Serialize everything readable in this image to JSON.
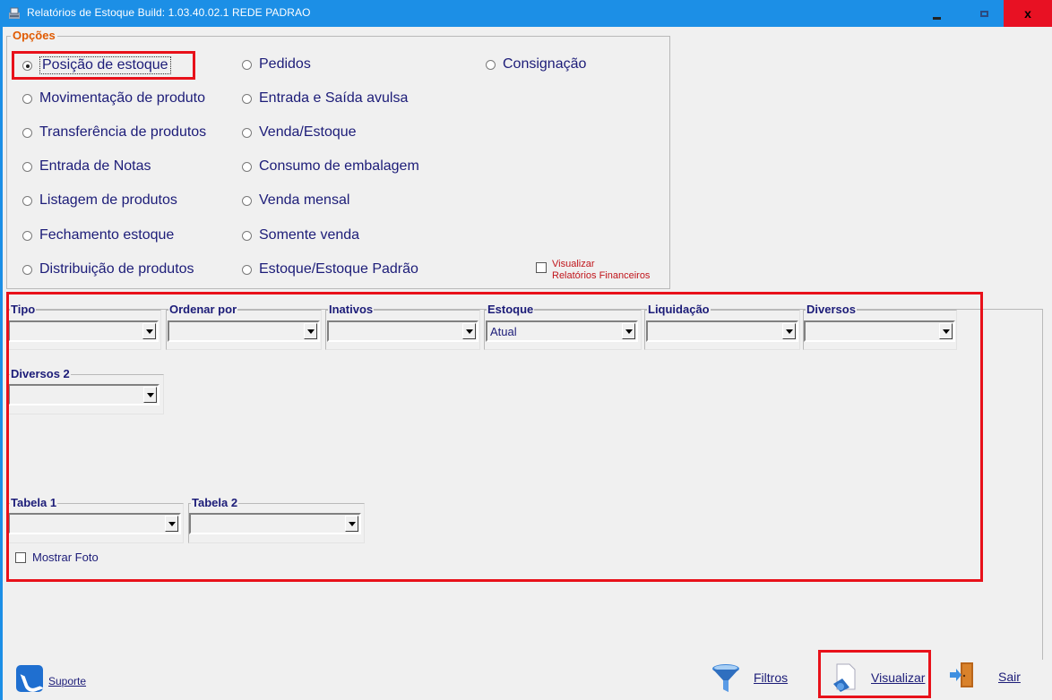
{
  "window": {
    "title": "Relatórios de Estoque    Build: 1.03.40.02.1   REDE PADRAO",
    "minimize_icon": "minimize-icon",
    "maximize_icon": "maximize-icon",
    "close_label": "x"
  },
  "opcoes": {
    "legend": "Opções",
    "radios": [
      {
        "label": "Posição de estoque",
        "checked": true
      },
      {
        "label": "Movimentação de produto",
        "checked": false
      },
      {
        "label": "Transferência de produtos",
        "checked": false
      },
      {
        "label": "Entrada de Notas",
        "checked": false
      },
      {
        "label": "Listagem de produtos",
        "checked": false
      },
      {
        "label": "Fechamento estoque",
        "checked": false
      },
      {
        "label": "Distribuição de produtos",
        "checked": false
      },
      {
        "label": "Pedidos",
        "checked": false
      },
      {
        "label": "Entrada e Saída avulsa",
        "checked": false
      },
      {
        "label": "Venda/Estoque",
        "checked": false
      },
      {
        "label": "Consumo de embalagem",
        "checked": false
      },
      {
        "label": "Venda mensal",
        "checked": false
      },
      {
        "label": "Somente venda",
        "checked": false
      },
      {
        "label": "Estoque/Estoque Padrão",
        "checked": false
      },
      {
        "label": "Consignação",
        "checked": false
      }
    ],
    "visualizar_check": {
      "line1": "Visualizar",
      "line2": "Relatórios Financeiros",
      "checked": false
    }
  },
  "filters": {
    "tipo": {
      "label": "Tipo",
      "value": ""
    },
    "ordenar": {
      "label": "Ordenar por",
      "value": ""
    },
    "inativos": {
      "label": "Inativos",
      "value": ""
    },
    "estoque": {
      "label": "Estoque",
      "value": "Atual"
    },
    "liquidacao": {
      "label": "Liquidação",
      "value": ""
    },
    "diversos": {
      "label": "Diversos",
      "value": ""
    },
    "diversos2": {
      "label": "Diversos 2",
      "value": ""
    },
    "tabela1": {
      "label": "Tabela 1",
      "value": ""
    },
    "tabela2": {
      "label": "Tabela 2",
      "value": ""
    },
    "mostrar_foto": {
      "label": "Mostrar Foto",
      "checked": false
    }
  },
  "buttons": {
    "suporte": "Suporte",
    "filtros": "Filtros",
    "visualizar": "Visualizar",
    "sair": "Sair"
  },
  "colors": {
    "titlebar": "#1c8fe6",
    "close": "#e81123",
    "highlight": "#e8111a",
    "label_text": "#1c1c78",
    "legend_orange": "#e05a00"
  }
}
